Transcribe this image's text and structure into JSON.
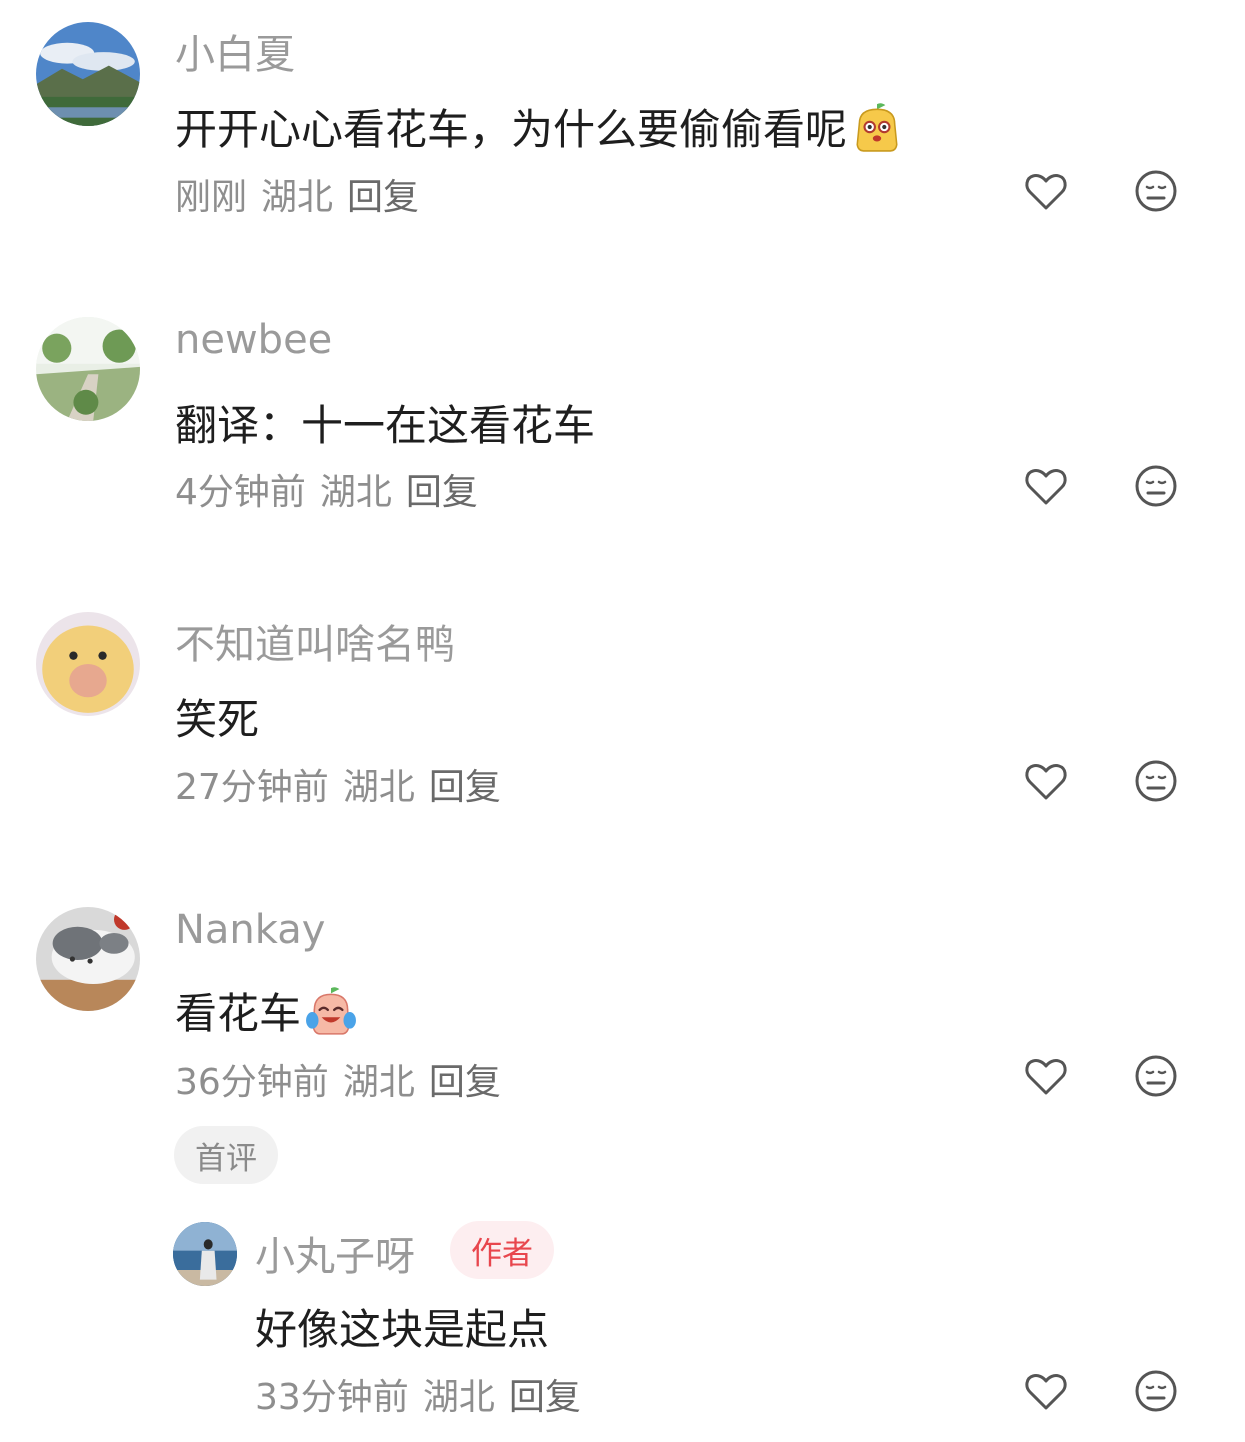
{
  "comments": [
    {
      "username": "小白夏",
      "text": "开开心心看花车，为什么要偷偷看呢",
      "emoji": "yellow-sprout-face-emoji",
      "time": "刚刚",
      "location": "湖北",
      "reply_label": "回复",
      "avatar": "landscape-avatar"
    },
    {
      "username": "newbee",
      "text": "翻译：十一在这看花车",
      "time": "4分钟前",
      "location": "湖北",
      "reply_label": "回复",
      "avatar": "garden-path-avatar"
    },
    {
      "username": "不知道叫啥名鸭",
      "text": "笑死",
      "time": "27分钟前",
      "location": "湖北",
      "reply_label": "回复",
      "avatar": "duck-avatar"
    },
    {
      "username": "Nankay",
      "text": "看花车",
      "emoji": "laughing-crying-face-emoji",
      "time": "36分钟前",
      "location": "湖北",
      "reply_label": "回复",
      "avatar": "cat-avatar",
      "badge": "首评"
    }
  ],
  "reply": {
    "username": "小丸子呀",
    "author_badge": "作者",
    "text": "好像这块是起点",
    "time": "33分钟前",
    "location": "湖北",
    "reply_label": "回复",
    "avatar": "seaside-person-avatar"
  },
  "icons": {
    "like": "heart-icon",
    "dislike": "neutral-face-icon"
  },
  "colors": {
    "username": "#9a9a9a",
    "content": "#1e1e1e",
    "meta": "#8e8e8e",
    "author_badge_text": "#e8464d",
    "author_badge_bg": "#fdeef0"
  }
}
